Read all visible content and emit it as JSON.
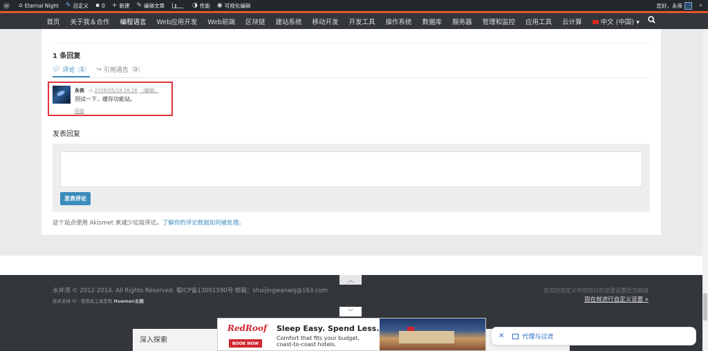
{
  "admin_bar": {
    "site_name": "Eternal Night",
    "customize": "自定义",
    "comments": "0",
    "new": "新建",
    "edit_post": "编辑文章",
    "performance": "性能",
    "visual_edit": "可视化编辑",
    "greeting": "您好，永夜"
  },
  "nav": {
    "items": [
      "首页",
      "关于我＆合作",
      "编程语言",
      "Web应用开发",
      "Web前端",
      "区块链",
      "建站系统",
      "移动开发",
      "开发工具",
      "操作系统",
      "数据库",
      "服务器",
      "管理和监控",
      "应用工具",
      "云计算"
    ],
    "language": "中文 (中国)",
    "language_caret": "▾"
  },
  "comments_section": {
    "reply_count": "1 条回复",
    "tab_comments": "评论",
    "tab_comments_count": "1",
    "tab_pingbacks": "引用通告",
    "tab_pingbacks_count": "0",
    "comment": {
      "author": "永夜",
      "datetime": "2026/05/18 16:26",
      "edit": "（编辑）",
      "text": "测试一下，缓存功能站。",
      "reply": "回复"
    },
    "leave_reply": "发表回复",
    "submit": "发表评论",
    "akismet_text": "这个站点使用 Akismet 来减少垃圾评论。",
    "akismet_link": "了解你的评论数据如何被处理。"
  },
  "footer": {
    "copyright": "水井湾 © 2012-2014. All Rights Reserved. 蜀ICP备13001590号 邮箱：shuijingwanwq@163.com",
    "powered_prefix": "技术支持 ",
    "powered_middle": " - 使用此工具定制 ",
    "powered_theme": "Hueman主题",
    "social_hint": "在实时自定义中您可以在这里设置社交链接",
    "customize_link": "现在就进行自定义设置 »",
    "explore": "深入探索"
  },
  "ad": {
    "brand": "RedRoof",
    "book": "BOOK NOW",
    "headline": "Sleep Easy. Spend Less.®",
    "line1": "Comfort that fits your budget,",
    "line2": "coast-to-coast hotels."
  },
  "proxy_panel": {
    "label": "代理与过滤"
  },
  "colors": {
    "accent": "#3b8dbd",
    "admin_bar": "#23282d",
    "nav": "#33363b",
    "orange": "#e8572a",
    "highlight": "#e0333b"
  }
}
